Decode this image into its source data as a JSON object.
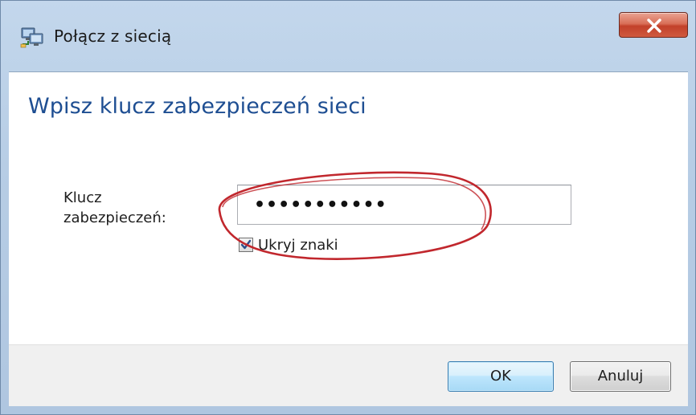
{
  "window": {
    "title": "Połącz z siecią",
    "icon": "network-connect-icon",
    "close_icon": "close-x-icon"
  },
  "main": {
    "heading": "Wpisz klucz zabezpieczeń sieci",
    "key_label": "Klucz zabezpieczeń:",
    "key_value": "•••••••••••",
    "hide_chars_label": "Ukryj znaki",
    "hide_chars_checked": true
  },
  "footer": {
    "ok_label": "OK",
    "cancel_label": "Anuluj"
  },
  "colors": {
    "heading": "#1e4e92",
    "annotation": "#c1272d",
    "close_button": "#c2412a"
  }
}
